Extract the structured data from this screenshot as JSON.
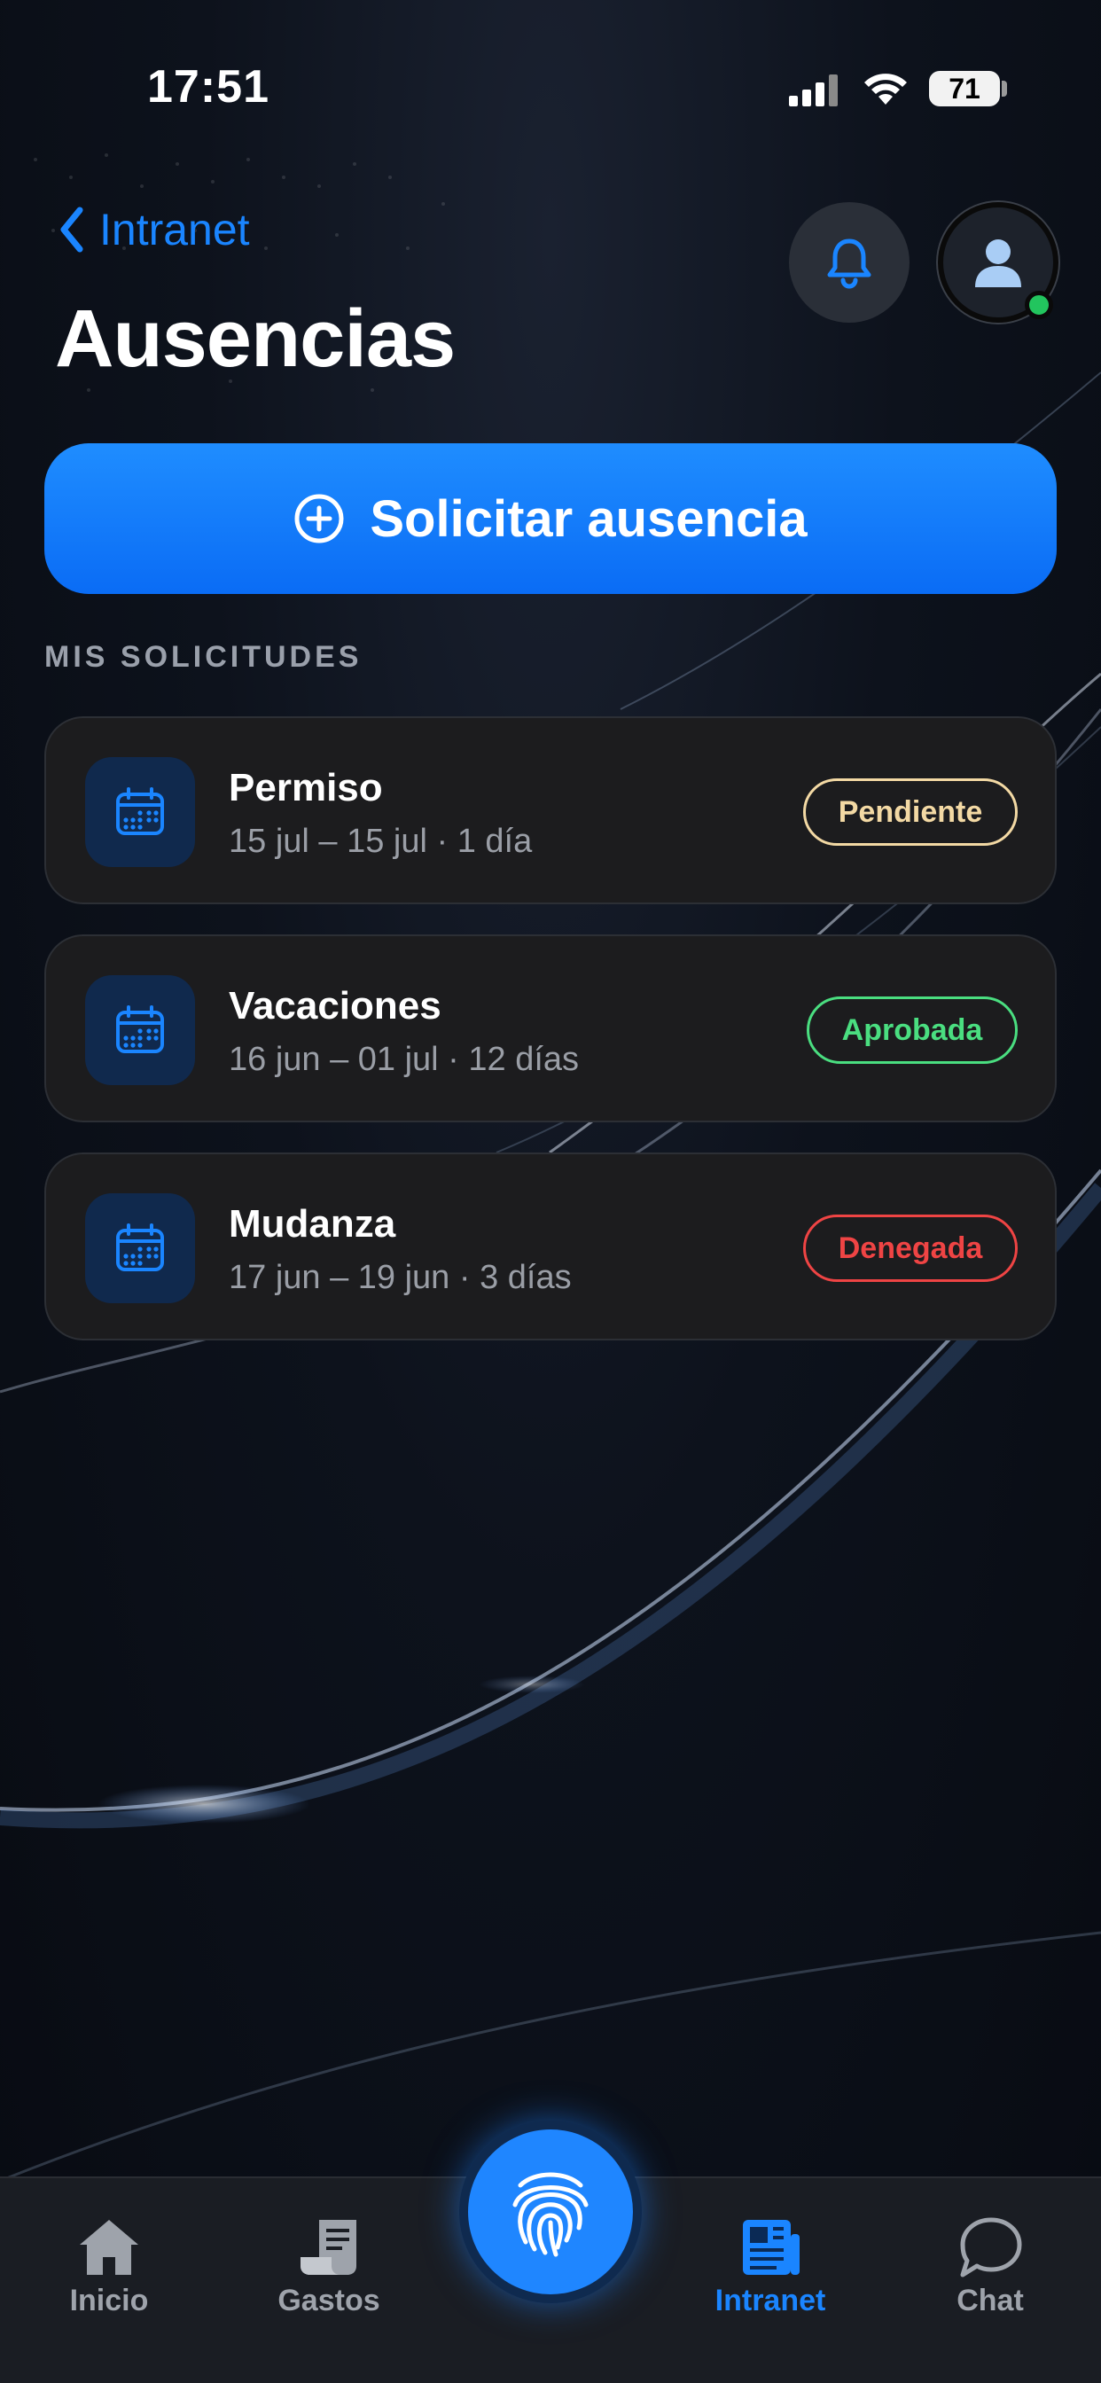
{
  "status_bar": {
    "time": "17:51",
    "battery": "71"
  },
  "header": {
    "back_label": "Intranet",
    "title": "Ausencias"
  },
  "primary_action": {
    "label": "Solicitar ausencia"
  },
  "section": {
    "label": "MIS SOLICITUDES"
  },
  "requests": [
    {
      "title": "Permiso",
      "detail": "15 jul – 15 jul · 1 día",
      "status": "Pendiente",
      "status_color": "#f3d9a4"
    },
    {
      "title": "Vacaciones",
      "detail": "16 jun – 01 jul · 12 días",
      "status": "Aprobada",
      "status_color": "#4ade80"
    },
    {
      "title": "Mudanza",
      "detail": "17 jun – 19 jun · 3 días",
      "status": "Denegada",
      "status_color": "#ef4444"
    }
  ],
  "tabbar": {
    "items": [
      {
        "label": "Inicio",
        "icon": "home-icon",
        "active": false
      },
      {
        "label": "Gastos",
        "icon": "receipt-icon",
        "active": false
      },
      {
        "label": "Intranet",
        "icon": "newspaper-icon",
        "active": true
      },
      {
        "label": "Chat",
        "icon": "chat-bubble-icon",
        "active": false
      }
    ],
    "center_icon": "fingerprint-icon"
  },
  "colors": {
    "accent": "#1a85ff",
    "card_bg": "#1c1c1e",
    "tab_inactive": "#9ea3ab",
    "online": "#22c55e"
  }
}
